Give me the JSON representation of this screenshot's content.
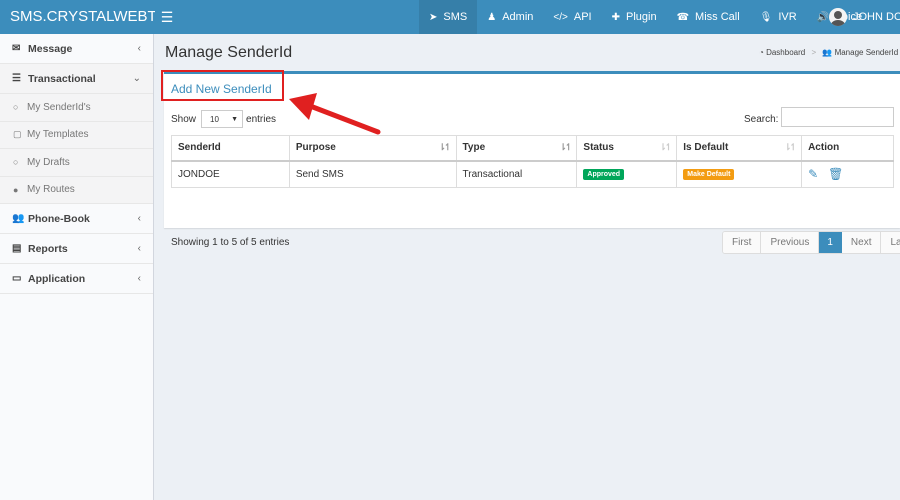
{
  "brand": {
    "title": "SMS.CRYSTALWEBTECH"
  },
  "topnav": [
    {
      "label": "SMS",
      "icon": "paper-plane-icon",
      "glyph": "➤",
      "active": true
    },
    {
      "label": "Admin",
      "icon": "user-secret-icon",
      "glyph": "♟"
    },
    {
      "label": "API",
      "icon": "code-icon",
      "glyph": "</>"
    },
    {
      "label": "Plugin",
      "icon": "puzzle-icon",
      "glyph": "✚"
    },
    {
      "label": "Miss Call",
      "icon": "phone-icon",
      "glyph": "☎"
    },
    {
      "label": "IVR",
      "icon": "microphone-icon",
      "glyph": "🎙"
    },
    {
      "label": "Voice",
      "icon": "volume-icon",
      "glyph": "🔊"
    }
  ],
  "user": {
    "name": "JOHN DOE"
  },
  "sidebar": {
    "items": [
      {
        "label": "Message",
        "icon": "envelope-icon",
        "glyph": "✉"
      },
      {
        "label": "Transactional",
        "icon": "list-icon",
        "glyph": "☰"
      },
      {
        "label": "Phone-Book",
        "icon": "users-icon",
        "glyph": "👥"
      },
      {
        "label": "Reports",
        "icon": "table-icon",
        "glyph": "▤"
      },
      {
        "label": "Application",
        "icon": "laptop-icon",
        "glyph": "▭"
      }
    ],
    "subitems": [
      {
        "label": "My SenderId's",
        "icon": "comment-icon",
        "glyph": "○"
      },
      {
        "label": "My Templates",
        "icon": "sticky-note-icon",
        "glyph": "▢"
      },
      {
        "label": "My Drafts",
        "icon": "circle-icon",
        "glyph": "○"
      },
      {
        "label": "My Routes",
        "icon": "dot-circle-icon",
        "glyph": "●"
      }
    ]
  },
  "page": {
    "title": "Manage SenderId",
    "breadcrumb": {
      "dashboard": "Dashboard",
      "current": "Manage SenderId"
    }
  },
  "box": {
    "add_label": "Add New SenderId",
    "show_label": "Show",
    "entries_value": "10",
    "entries_label": "entries",
    "search_label": "Search:",
    "search_value": ""
  },
  "table": {
    "headers": [
      "SenderId",
      "Purpose",
      "Type",
      "Status",
      "Is Default",
      "Action"
    ],
    "rows": [
      {
        "senderid": "JONDOE",
        "purpose": "Send SMS",
        "type": "Transactional",
        "status": "Approved",
        "is_default": "Make Default"
      }
    ]
  },
  "footer": {
    "showing": "Showing 1 to 5 of 5 entries",
    "pager": [
      "First",
      "Previous",
      "1",
      "Next",
      "Last"
    ],
    "current_page": "1"
  },
  "colors": {
    "header": "#3c8dbc",
    "approved": "#00a65a",
    "make_default": "#f39c12",
    "annotation": "#e02020"
  }
}
